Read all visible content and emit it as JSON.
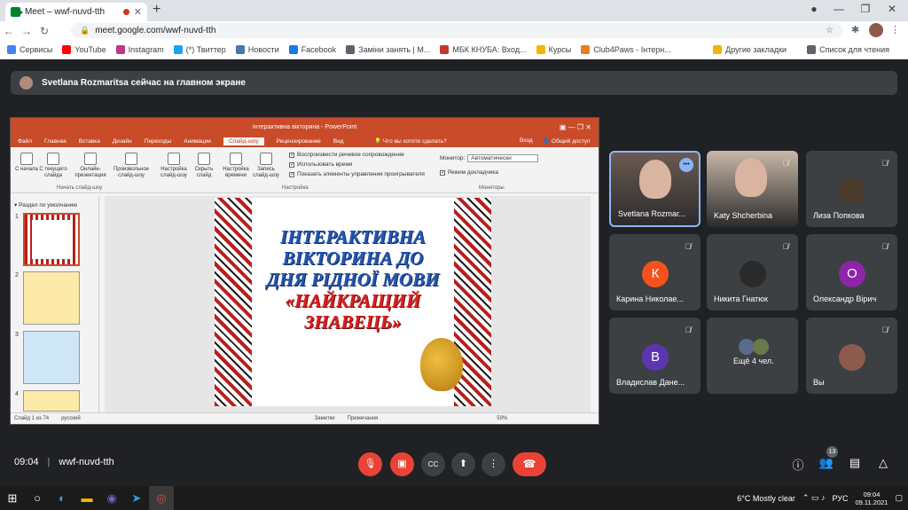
{
  "browser": {
    "tab_title": "Meet – wwf-nuvd-tth",
    "url": "meet.google.com/wwf-nuvd-tth",
    "bookmarks": [
      {
        "label": "Сервисы",
        "color": "#4285f4"
      },
      {
        "label": "YouTube",
        "color": "#ff0000"
      },
      {
        "label": "Instagram",
        "color": "#c13584"
      },
      {
        "label": "(*) Твиттер",
        "color": "#1da1f2"
      },
      {
        "label": "Новости",
        "color": "#4a76a8"
      },
      {
        "label": "Facebook",
        "color": "#1877f2"
      },
      {
        "label": "Заміни занять | М...",
        "color": "#5f6368"
      },
      {
        "label": "МБК КНУБА: Вход...",
        "color": "#c0392b"
      },
      {
        "label": "Курсы",
        "color": "#f4b400"
      },
      {
        "label": "Club4Paws - Інтерн...",
        "color": "#e67e22"
      }
    ],
    "other_bookmarks": "Другие закладки",
    "reading_list": "Список для чтения"
  },
  "presentation_banner": "Svetlana Rozmaritsa сейчас на главном экране",
  "powerpoint": {
    "title": "Інтерактивна вікторина - PowerPoint",
    "tabs": [
      "Файл",
      "Главная",
      "Вставка",
      "Дизайн",
      "Переходы",
      "Анимации",
      "Слайд-шоу",
      "Рецензирование",
      "Вид"
    ],
    "tell_me": "Что вы хотите сделать?",
    "sign_in": "Вход",
    "share": "Общий доступ",
    "ribbon_buttons": [
      "С начала",
      "С текущего слайда",
      "Онлайн-презентация",
      "Произвольное слайд-шоу",
      "Настройка слайд-шоу",
      "Скрыть слайд",
      "Настройка времени",
      "Запись слайд-шоу"
    ],
    "group_start": "Начать слайд-шоу",
    "group_setup": "Настройка",
    "group_monitors": "Мониторы",
    "checks": [
      "Воспроизвести речевое сопровождение",
      "Использовать время",
      "Показать элементы управления проигрывателя"
    ],
    "monitor_label": "Монитор:",
    "monitor_value": "Автоматически",
    "presenter_view": "Режим докладчика",
    "section": "Раздел по умолчанию",
    "slide_lines": [
      "ІНТЕРАКТИВНА",
      "ВІКТОРИНА ДО",
      "ДНЯ РІДНОЇ МОВИ",
      "«НАЙКРАЩИЙ",
      "ЗНАВЕЦЬ»"
    ],
    "status_slide": "Слайд 1 из 74",
    "status_lang": "русский",
    "notes": "Заметки",
    "comments": "Примечания",
    "zoom": "59%"
  },
  "participants": [
    {
      "name": "Svetlana Rozmar...",
      "type": "video",
      "color": "#6b5a52"
    },
    {
      "name": "Katy Shcherbina",
      "type": "video",
      "color": "#c9b8a8"
    },
    {
      "name": "Лиза Попкова",
      "type": "avatar",
      "initial": "",
      "color": "#4a3b2a"
    },
    {
      "name": "Карина Николае...",
      "type": "avatar",
      "initial": "К",
      "color": "#f4511e"
    },
    {
      "name": "Никита Гнатюк",
      "type": "avatar",
      "initial": "",
      "color": "#2a2a2a"
    },
    {
      "name": "Олександр Вірич",
      "type": "avatar",
      "initial": "О",
      "color": "#8e24aa"
    },
    {
      "name": "Владислав Дане...",
      "type": "avatar",
      "initial": "В",
      "color": "#5e35b1"
    },
    {
      "name": "Ещё 4 чел.",
      "type": "more",
      "initial": "",
      "color": "#3c4043"
    },
    {
      "name": "Вы",
      "type": "avatar",
      "initial": "",
      "color": "#8d5b4c"
    }
  ],
  "meeting": {
    "time": "09:04",
    "code": "wwf-nuvd-tth",
    "people_count": "13"
  },
  "taskbar": {
    "weather": "6°C  Mostly clear",
    "lang": "РУС",
    "time": "09:04",
    "date": "09.11.2021"
  }
}
